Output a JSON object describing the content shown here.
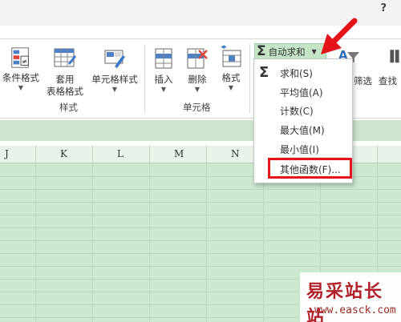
{
  "titlebar": {
    "help": "?"
  },
  "ribbon": {
    "buttons": {
      "conditional_format": "条件格式",
      "table_format_line1": "套用",
      "table_format_line2": "表格格式",
      "cell_style": "单元格样式",
      "insert": "插入",
      "delete": "删除",
      "format": "格式",
      "filter": "筛选",
      "find": "查找"
    },
    "groups": {
      "styles": "样式",
      "cells": "单元格"
    },
    "autosum": {
      "label": "自动求和"
    }
  },
  "menu": {
    "items": [
      {
        "label": "求和(S)"
      },
      {
        "label": "平均值(A)"
      },
      {
        "label": "计数(C)"
      },
      {
        "label": "最大值(M)"
      },
      {
        "label": "最小值(I)"
      },
      {
        "label": "其他函数(F)..."
      }
    ]
  },
  "sheet": {
    "columns": [
      "J",
      "K",
      "L",
      "M",
      "N"
    ]
  },
  "colors": {
    "highlight": "#e5141b",
    "sheet_bg": "#cce8cf",
    "autosum_bg": "#c5e5c8"
  },
  "watermark": {
    "brand": "易采站长站",
    "url": "www.easck.com"
  }
}
